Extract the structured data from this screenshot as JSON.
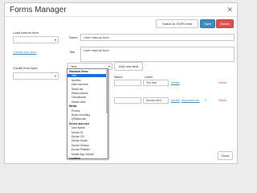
{
  "dialog": {
    "title": "Forms Manager",
    "close_glyph": "✕"
  },
  "toolbar": {
    "json_view_label": "Switch to JSON view",
    "save_label": "Save",
    "delete_label": "Delete"
  },
  "sidebar": {
    "load_label": "Load custom form",
    "load_select_value": "",
    "create_new_form_label": "Create new form",
    "create_from_label": "Create from layer",
    "create_select_value": ""
  },
  "form": {
    "name_label": "Name",
    "name_value": "User manual form",
    "title_label": "Title",
    "title_value": "User manual form",
    "field_type_value": "Text",
    "add_field_label": "Add new field"
  },
  "fields_table": {
    "headers": [
      "Name",
      "Label"
    ],
    "rows": [
      {
        "label_value": "Text field",
        "details": "Details",
        "delete": "Delete"
      },
      {
        "label_value": "Number field",
        "details": "Details",
        "dependencies": "Dependencies",
        "delete": "Delete"
      }
    ]
  },
  "dropdown": {
    "items": [
      {
        "kind": "group",
        "label": "Standard items"
      },
      {
        "kind": "option",
        "label": "Text",
        "selected": true
      },
      {
        "kind": "option",
        "label": "Number"
      },
      {
        "kind": "option",
        "label": "Date and time"
      },
      {
        "kind": "option",
        "label": "Select list"
      },
      {
        "kind": "option",
        "label": "Radio buttons"
      },
      {
        "kind": "option",
        "label": "Checkboxes"
      },
      {
        "kind": "option",
        "label": "Hidden field"
      },
      {
        "kind": "group",
        "label": "Media"
      },
      {
        "kind": "option",
        "label": "Photos"
      },
      {
        "kind": "option",
        "label": "Audio recording"
      },
      {
        "kind": "option",
        "label": "QR/Barcode"
      },
      {
        "kind": "group",
        "label": "Device and user"
      },
      {
        "kind": "option",
        "label": "User Name"
      },
      {
        "kind": "option",
        "label": "Device ID"
      },
      {
        "kind": "option",
        "label": "Device OS"
      },
      {
        "kind": "option",
        "label": "Device Model"
      },
      {
        "kind": "option",
        "label": "Device Version"
      },
      {
        "kind": "option",
        "label": "Device Platform"
      },
      {
        "kind": "option",
        "label": "Mobile App Version"
      },
      {
        "kind": "group",
        "label": "Location"
      }
    ]
  },
  "footer": {
    "close_label": "Close"
  },
  "colors": {
    "accent": "#3c8dbc",
    "danger": "#d9534f",
    "selection": "#1e70d8"
  }
}
